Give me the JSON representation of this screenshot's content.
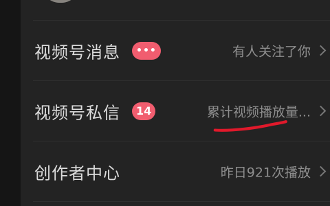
{
  "rows": [
    {
      "title": "视频号消息",
      "badge": "•••",
      "value": "有人关注了你"
    },
    {
      "title": "视频号私信",
      "badge": "14",
      "value": "累计视频播放量..."
    },
    {
      "title": "创作者中心",
      "badge": "",
      "value": "昨日921次播放"
    }
  ],
  "colors": {
    "background": "#232323",
    "badge": "#f15d6f",
    "title_text": "#dcdcdc",
    "value_text": "#8e8e8e",
    "annotation": "#e0192b"
  },
  "icons": {
    "chevron": "chevron-right-icon"
  }
}
